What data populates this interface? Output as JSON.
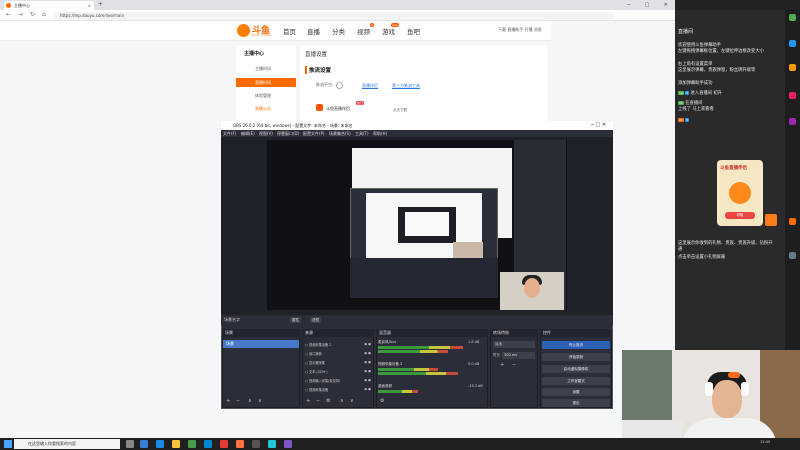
{
  "browser": {
    "tab_title": "主播中心",
    "tab_close": "×",
    "new_tab": "+",
    "url": "https://mp.douyu.com/live/main",
    "nav_back": "←",
    "nav_forward": "→",
    "nav_refresh": "↻",
    "nav_home": "⌂",
    "win_min": "─",
    "win_max": "□",
    "win_close": "✕"
  },
  "site": {
    "logo_text": "斗鱼",
    "logo_sub": "DOUYU.COM",
    "nav": [
      {
        "label": "首页"
      },
      {
        "label": "直播"
      },
      {
        "label": "分类"
      },
      {
        "label": "视频",
        "badge": "3"
      },
      {
        "label": "游戏",
        "badge": "new"
      },
      {
        "label": "鱼吧"
      }
    ],
    "header_right": "下载   直播助手   开播   消息"
  },
  "leftmenu": {
    "title": "主播中心",
    "items": [
      {
        "label": "主播时间"
      },
      {
        "label": "直播时间"
      },
      {
        "label": "体验管理"
      },
      {
        "label": "直播公告"
      }
    ]
  },
  "card": {
    "title": "直播设置",
    "subtitle": "推流设置",
    "platform_label": "推流平台:",
    "link_1": "直播伴侣",
    "link_2": "第三方推流工具",
    "assistant_name": "斗鱼直播伴侣",
    "hot_tag": "热门",
    "download": "点击下载"
  },
  "obs": {
    "title": "OBS 26.0.2 (64-bit, windows) - 配置文件: 未命名 - 场景: 未命名",
    "menu": [
      "文件(F)",
      "编辑(E)",
      "视图(V)",
      "停靠窗口(D)",
      "配置文件(P)",
      "场景集合(S)",
      "工具(T)",
      "帮助(H)"
    ],
    "scene_label": "场景名字",
    "scene_btn_1": "属性",
    "scene_btn_2": "滤镜",
    "docks": {
      "scenes": "场景",
      "sources": "来源",
      "mixer": "混音器",
      "transitions": "转场特效",
      "controls": "控件"
    },
    "scene_items": [
      "场景"
    ],
    "sources": [
      "视频采集设备 2",
      "窗口捕获",
      "显示器采集",
      "文本 (GDI+)",
      "音频输入采集(麦克风)",
      "视频采集设备"
    ],
    "mixer": [
      {
        "name": "麦克风/Aux",
        "db": "1.8 dB"
      },
      {
        "name": "视频采集设备 2",
        "db": "0.0 dB"
      },
      {
        "name": "桌面音频",
        "db": "-16.3 dB"
      }
    ],
    "transition_type": "淡出",
    "duration_label": "时长",
    "duration_value": "300 ms",
    "controls": [
      "停止推流",
      "开始录制",
      "启动虚拟摄像机",
      "工作室模式",
      "设置",
      "退出"
    ],
    "add": "+",
    "remove": "−",
    "up": "∧",
    "down": "∨",
    "gear": "⚙"
  },
  "danmu": {
    "room": "直播间",
    "lines": [
      "欢迎使用斗鱼弹幕助手",
      "左键拖拽弹幕框位置，左键拉伸边框改变大小",
      "右上角有设置菜单",
      "这里展示弹幕，贵族弹窗，粉丝牌升级等",
      "添加弹幕助手成功"
    ],
    "user_1": "初升",
    "user_2": "在直播间",
    "event_1": "进入直播间",
    "event_2": "在直播间",
    "event_3": "上线了 马上来看看",
    "gift_title": "斗鱼直播伴侣",
    "gift_btn": "领取",
    "tips": [
      "这里展示你收到的礼物、贵族、贵族升级、钻粉开通",
      "点击单击设置小礼物屏蔽"
    ]
  },
  "taskbar": {
    "search_placeholder": "在这里输入你要搜索的内容",
    "clock": "12:40"
  },
  "colors": {
    "brand": "#ff6a00",
    "obs_bg": "#2b2e38",
    "stream_btn": "#2d5fb7"
  }
}
